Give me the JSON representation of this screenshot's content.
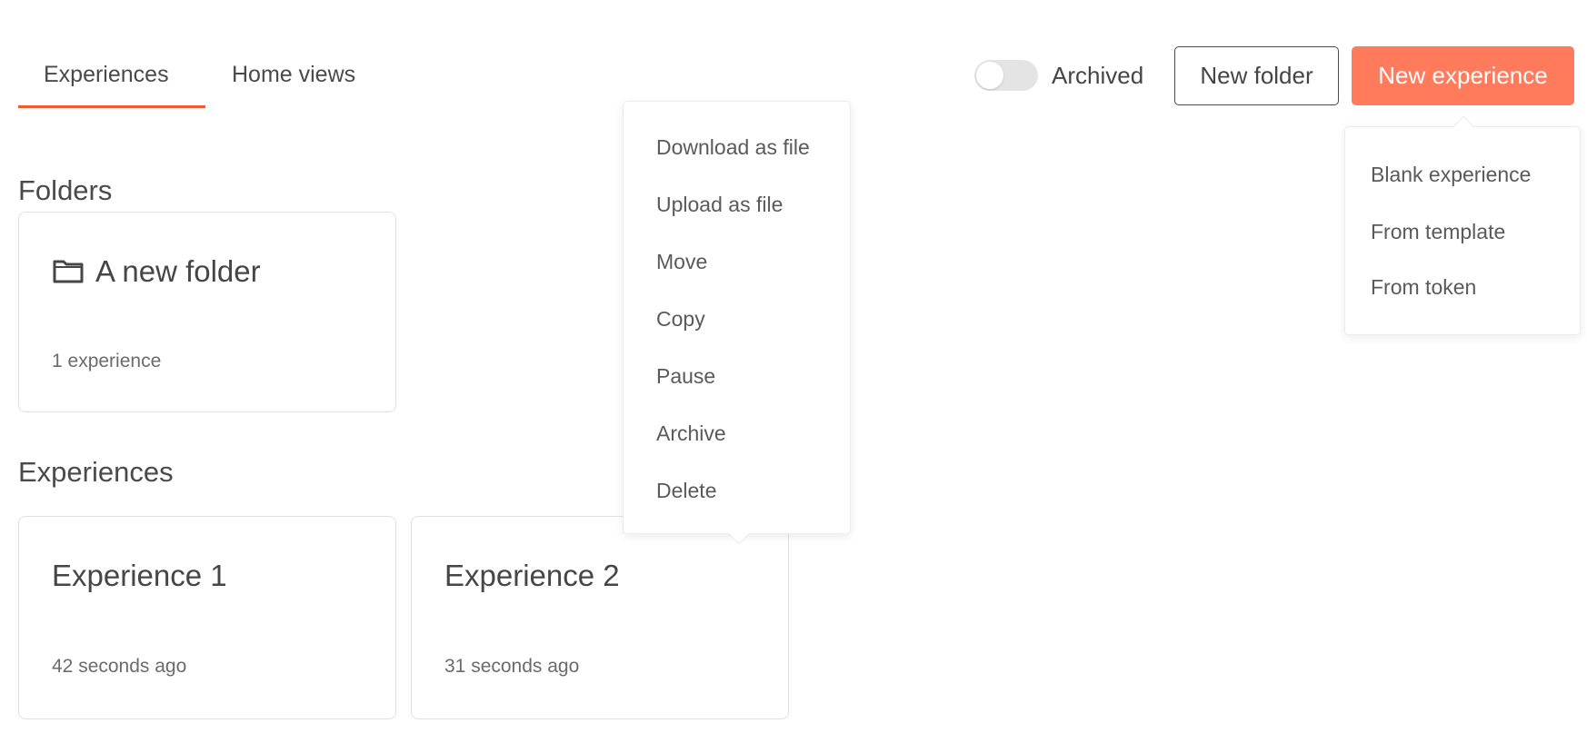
{
  "tabs": [
    {
      "label": "Experiences",
      "active": true
    },
    {
      "label": "Home views",
      "active": false
    }
  ],
  "toolbar": {
    "archived_label": "Archived",
    "archived_on": false,
    "new_folder_label": "New folder",
    "new_experience_label": "New experience"
  },
  "new_experience_menu": {
    "items": [
      "Blank experience",
      "From template",
      "From token"
    ]
  },
  "context_menu": {
    "items": [
      "Download as file",
      "Upload as file",
      "Move",
      "Copy",
      "Pause",
      "Archive",
      "Delete"
    ]
  },
  "sections": {
    "folders_heading": "Folders",
    "experiences_heading": "Experiences"
  },
  "folders": [
    {
      "icon": "folder-icon",
      "name": "A new folder",
      "count": "1 experience"
    }
  ],
  "experiences": [
    {
      "name": "Experience 1",
      "updated": "42 seconds ago"
    },
    {
      "name": "Experience 2",
      "updated": "31 seconds ago"
    }
  ],
  "colors": {
    "accent": "#ee5a34",
    "primary_button": "#ff7b5c",
    "text": "#454545"
  }
}
